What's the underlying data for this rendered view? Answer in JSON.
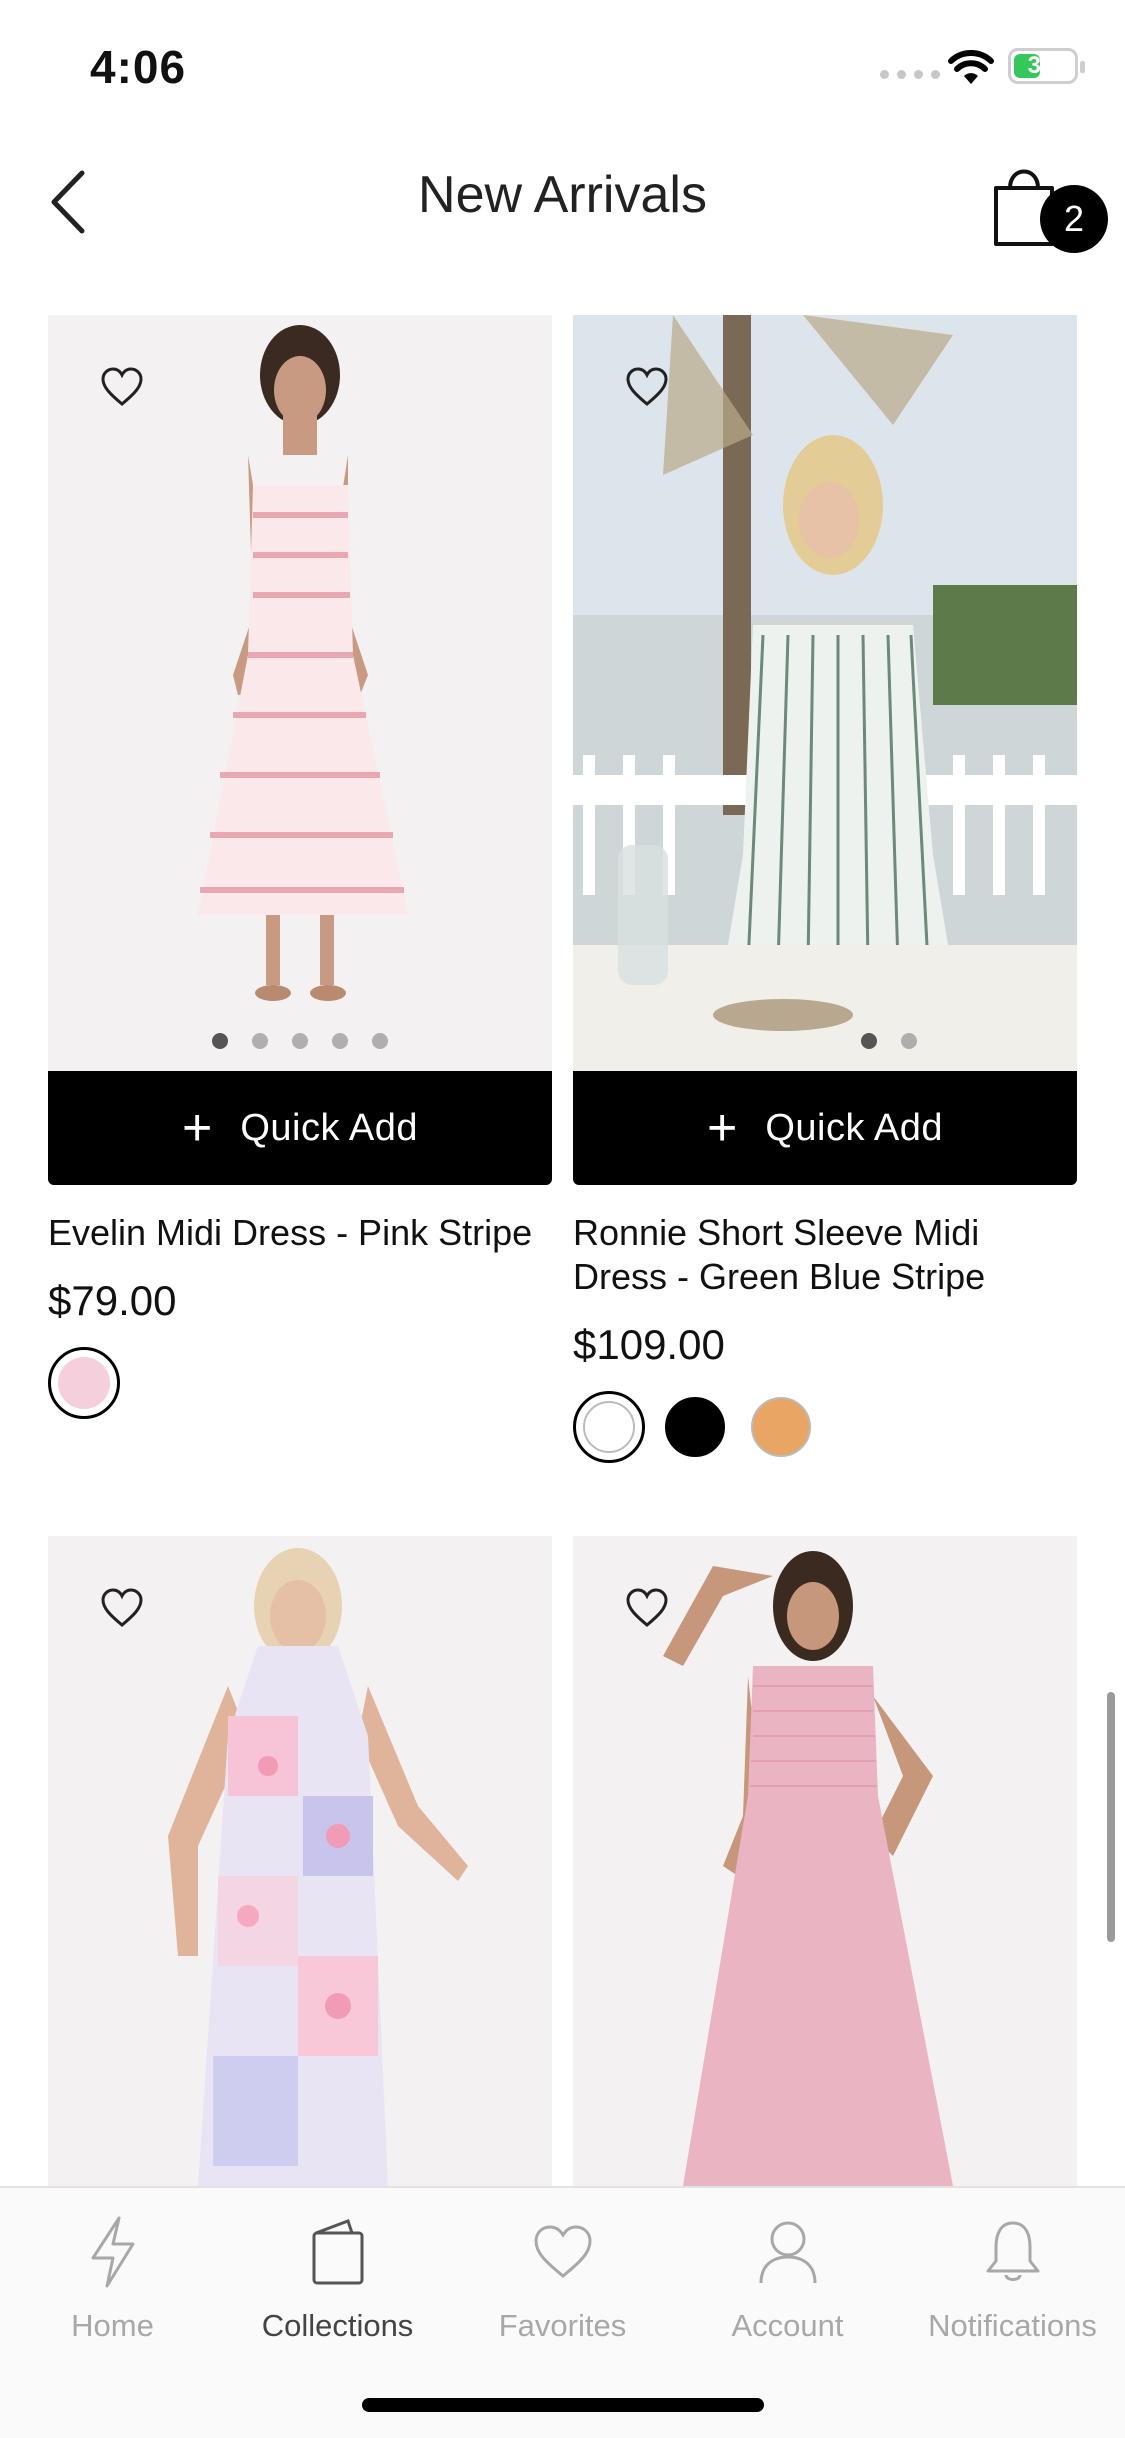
{
  "status_bar": {
    "time": "4:06",
    "battery": "37"
  },
  "header": {
    "title": "New Arrivals",
    "cart_count": "2"
  },
  "products": [
    {
      "name": "Evelin Midi Dress - Pink Stripe",
      "price": "$79.00",
      "quick_add": "Quick Add",
      "image": "woman in pink striped midi dress",
      "swatches": [
        "#f6cfdc"
      ]
    },
    {
      "name": "Ronnie Short Sleeve Midi Dress - Green Blue Stripe",
      "price": "$109.00",
      "quick_add": "Quick Add",
      "image": "woman in striped dress outdoors",
      "swatches": [
        "#ffffff",
        "#000000",
        "#e8a564"
      ]
    },
    {
      "image": "woman in pastel floral patchwork dress"
    },
    {
      "image": "woman in pink smocked maxi dress"
    }
  ],
  "tabs": [
    {
      "label": "Home",
      "icon": "lightning-icon"
    },
    {
      "label": "Collections",
      "icon": "collections-icon"
    },
    {
      "label": "Favorites",
      "icon": "heart-icon"
    },
    {
      "label": "Account",
      "icon": "person-icon"
    },
    {
      "label": "Notifications",
      "icon": "bell-icon"
    }
  ],
  "colors": {
    "accent": "#000000",
    "inactive_tab": "#a8a8a8"
  }
}
